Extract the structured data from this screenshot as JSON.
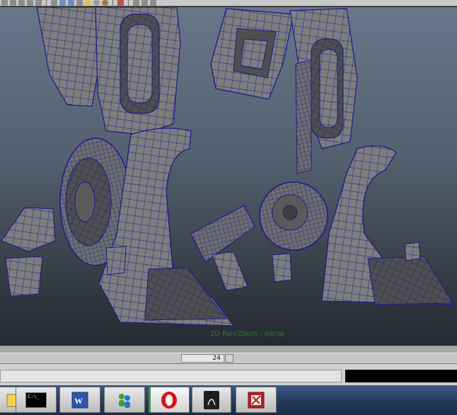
{
  "toolbar": {
    "buttons": [
      "new-scene",
      "open-scene",
      "save-scene",
      "undo",
      "redo",
      "camera-a",
      "camera-b",
      "camera-c",
      "select-tool",
      "light-a",
      "light-b",
      "light-c",
      "render",
      "snap-a",
      "snap-b",
      "snap-c"
    ]
  },
  "viewport": {
    "hud_label": "2D Pan/Zoom : persp",
    "wire_color": "#1c1c8c",
    "mesh_color": "#7e7e7e"
  },
  "timeline": {
    "current_frame": "24"
  },
  "taskbar": {
    "items": [
      {
        "name": "explorer",
        "icon": "folder-icon"
      },
      {
        "name": "command-prompt",
        "icon": "cmd-icon"
      },
      {
        "name": "word",
        "icon": "word-icon"
      },
      {
        "name": "messenger",
        "icon": "messenger-icon"
      },
      {
        "name": "opera",
        "icon": "opera-icon"
      },
      {
        "name": "maya",
        "icon": "maya-icon"
      },
      {
        "name": "acrobat",
        "icon": "pdf-icon"
      }
    ],
    "cmd_icon_text": "C:\\_"
  }
}
